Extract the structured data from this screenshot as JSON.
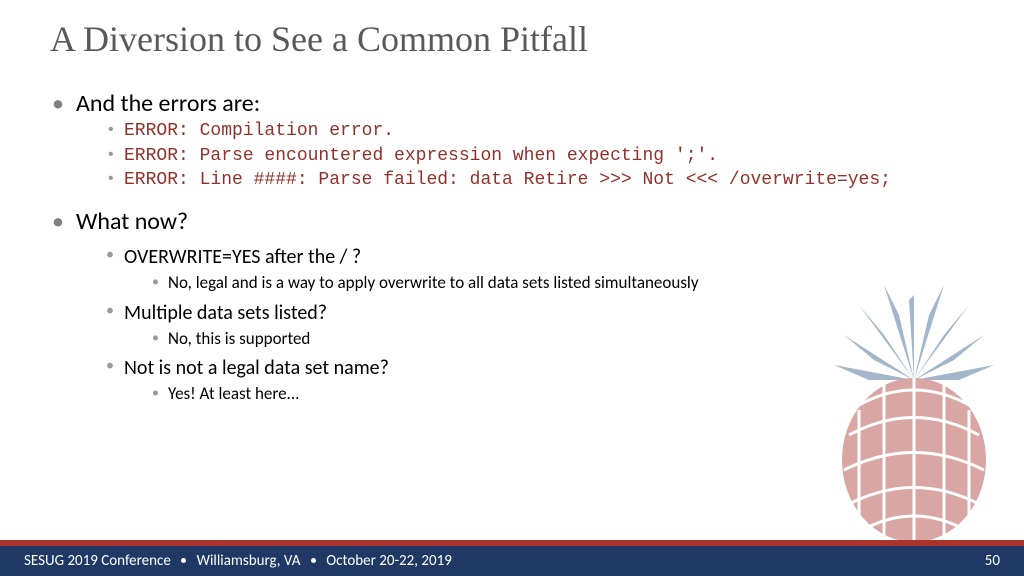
{
  "title": "A Diversion to See a Common Pitfall",
  "b1": {
    "label": "And the errors are:"
  },
  "err1": "ERROR: Compilation error.",
  "err2": "ERROR: Parse encountered expression when expecting ';'.",
  "err3": "ERROR: Line ####: Parse failed: data Retire  >>> Not <<< /overwrite=yes;",
  "b2": {
    "label": "What now?"
  },
  "q1": {
    "label": "OVERWRITE=YES after the / ?",
    "ans": "No, legal and is a way to apply overwrite to all data sets listed simultaneously"
  },
  "q2": {
    "label": "Multiple data sets listed?",
    "ans": "No, this is supported"
  },
  "q3": {
    "label": "Not is not a legal data set name?",
    "ans": "Yes! At least here..."
  },
  "footer": {
    "conf": "SESUG 2019 Conference",
    "loc": "Williamsburg, VA",
    "date": "October 20-22, 2019",
    "page": "50"
  }
}
